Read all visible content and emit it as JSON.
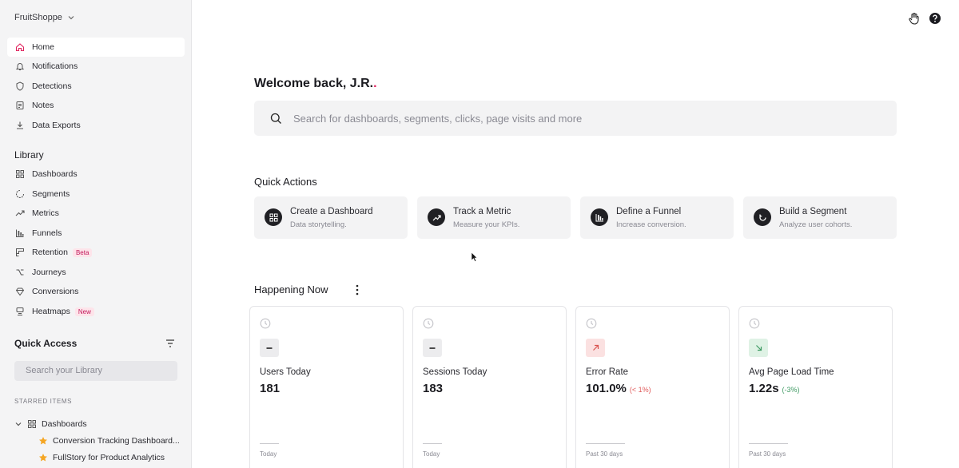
{
  "sidebar": {
    "org_name": "FruitShoppe",
    "nav": [
      {
        "label": "Home",
        "icon": "home-icon",
        "active": true
      },
      {
        "label": "Notifications",
        "icon": "bell-icon"
      },
      {
        "label": "Detections",
        "icon": "shield-icon"
      },
      {
        "label": "Notes",
        "icon": "note-icon"
      },
      {
        "label": "Data Exports",
        "icon": "download-icon"
      }
    ],
    "library_title": "Library",
    "library": [
      {
        "label": "Dashboards",
        "icon": "grid-icon"
      },
      {
        "label": "Segments",
        "icon": "segment-icon"
      },
      {
        "label": "Metrics",
        "icon": "trend-icon"
      },
      {
        "label": "Funnels",
        "icon": "funnel-bars-icon"
      },
      {
        "label": "Retention",
        "icon": "retention-icon",
        "badge": "Beta"
      },
      {
        "label": "Journeys",
        "icon": "journey-icon"
      },
      {
        "label": "Conversions",
        "icon": "diamond-icon"
      },
      {
        "label": "Heatmaps",
        "icon": "heatmap-icon",
        "badge": "New"
      }
    ],
    "quick_access_title": "Quick Access",
    "library_search_placeholder": "Search your Library",
    "starred_title": "STARRED ITEMS",
    "starred_folder": "Dashboards",
    "starred_items": [
      "Conversion Tracking Dashboard...",
      "FullStory for Product Analytics"
    ]
  },
  "main": {
    "welcome": "Welcome back, J.R.",
    "welcome_dot": ".",
    "search_placeholder": "Search for dashboards, segments, clicks, page visits and more",
    "quick_actions_title": "Quick Actions",
    "quick_actions": [
      {
        "title": "Create a Dashboard",
        "subtitle": "Data storytelling.",
        "icon": "grid-icon"
      },
      {
        "title": "Track a Metric",
        "subtitle": "Measure your KPIs.",
        "icon": "trend-up-icon"
      },
      {
        "title": "Define a Funnel",
        "subtitle": "Increase conversion.",
        "icon": "bars-icon"
      },
      {
        "title": "Build a Segment",
        "subtitle": "Analyze user cohorts.",
        "icon": "circle-arrow-icon"
      }
    ],
    "happening_title": "Happening Now",
    "metrics": [
      {
        "label": "Users Today",
        "value": "181",
        "delta": "",
        "period": "Today",
        "trend": "flat"
      },
      {
        "label": "Sessions Today",
        "value": "183",
        "delta": "",
        "period": "Today",
        "trend": "flat"
      },
      {
        "label": "Error Rate",
        "value": "101.0%",
        "delta": "(< 1%)",
        "period": "Past 30 days",
        "trend": "up-bad"
      },
      {
        "label": "Avg Page Load Time",
        "value": "1.22s",
        "delta": "(-3%)",
        "period": "Past 30 days",
        "trend": "down-good"
      }
    ]
  },
  "colors": {
    "accent": "#e0245e",
    "sidebar_bg": "#f4f4f5",
    "bad": "#e05a5a",
    "good": "#3f9a63"
  }
}
